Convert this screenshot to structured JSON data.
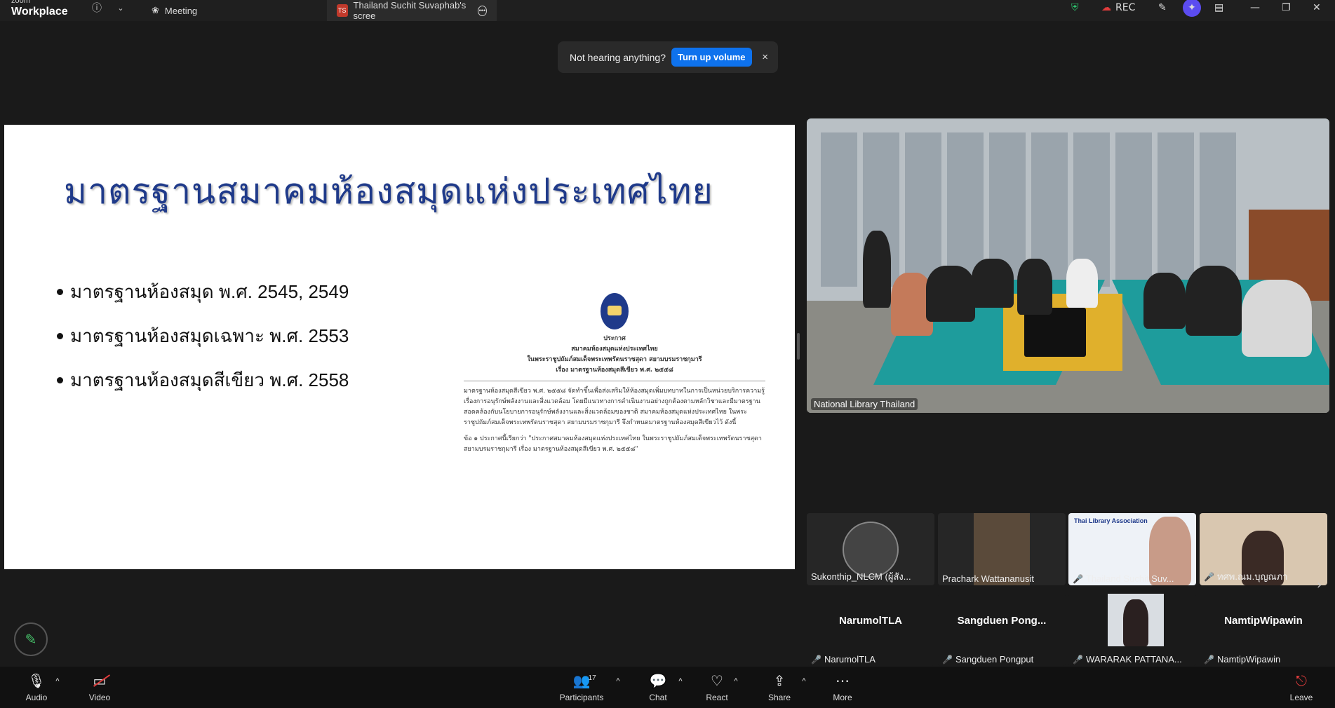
{
  "app": {
    "brand_small": "zoom",
    "brand_big": "Workplace"
  },
  "tabs": {
    "meeting": "Meeting",
    "share_badge": "TS",
    "share": "Thailand Suchit Suvaphab's scree"
  },
  "titlebar_right": {
    "rec": "REC"
  },
  "notification": {
    "text": "Not hearing anything?",
    "button": "Turn up volume",
    "close": "×"
  },
  "slide": {
    "title": "มาตรฐานสมาคมห้องสมุดแห่งประเทศไทย",
    "bullets": [
      "มาตรฐานห้องสมุด พ.ศ. 2545, 2549",
      "มาตรฐานห้องสมุดเฉพาะ  พ.ศ. 2553",
      "มาตรฐานห้องสมุดสีเขียว พ.ศ. 2558"
    ],
    "doc": {
      "h1": "ประกาศ",
      "h2": "สมาคมห้องสมุดแห่งประเทศไทย",
      "h3": "ในพระราชูปถัมภ์สมเด็จพระเทพรัตนราชสุดา สยามบรมราชกุมารี",
      "h4": "เรื่อง มาตรฐานห้องสมุดสีเขียว พ.ศ. ๒๕๕๘",
      "p1": "มาตรฐานห้องสมุดสีเขียว พ.ศ. ๒๕๕๘ จัดทำขึ้นเพื่อส่งเสริมให้ห้องสมุดเพิ่มบทบาทในการเป็นหน่วยบริการความรู้เรื่องการอนุรักษ์พลังงานและสิ่งแวดล้อม โดยมีแนวทางการดำเนินงานอย่างถูกต้องตามหลักวิชาและมีมาตรฐานสอดคล้องกับนโยบายการอนุรักษ์พลังงานและสิ่งแวดล้อมของชาติ สมาคมห้องสมุดแห่งประเทศไทย ในพระราชูปถัมภ์สมเด็จพระเทพรัตนราชสุดา สยามบรมราชกุมารี จึงกำหนดมาตรฐานห้องสมุดสีเขียวไว้ ดังนี้",
      "p2": "ข้อ ๑ ประกาศนี้เรียกว่า \"ประกาศสมาคมห้องสมุดแห่งประเทศไทย ในพระราชูปถัมภ์สมเด็จพระเทพรัตนราชสุดา สยามบรมราชกุมารี เรื่อง มาตรฐานห้องสมุดสีเขียว พ.ศ. ๒๕๕๘\""
    }
  },
  "main_video": {
    "name": "National Library Thailand"
  },
  "thumbs_row1": [
    {
      "name": "Sukonthip_NLCM (ผู้สัง...",
      "muted": false
    },
    {
      "name": "Prachark Wattananusit",
      "muted": false
    },
    {
      "name": "Thailand Suchit Suv...",
      "muted": true
    },
    {
      "name": "ทศพ.ณม.บุญณภา",
      "muted": true
    }
  ],
  "thumbs_row2": [
    {
      "big": "NarumolTLA",
      "name": "NarumolTLA",
      "muted": true
    },
    {
      "big": "Sangduen  Pong...",
      "name": "Sangduen Pongput",
      "muted": true
    },
    {
      "big": "",
      "name": "WARARAK PATTANA...",
      "muted": true
    },
    {
      "big": "NamtipWipawin",
      "name": "NamtipWipawin",
      "muted": true
    }
  ],
  "toolbar": {
    "audio": "Audio",
    "video": "Video",
    "participants": "Participants",
    "participants_count": "17",
    "chat": "Chat",
    "react": "React",
    "share": "Share",
    "more": "More",
    "leave": "Leave"
  },
  "icons": {
    "accent": "#0e72ed",
    "muted": "#e03c3c",
    "annotate": "#46c36a"
  }
}
